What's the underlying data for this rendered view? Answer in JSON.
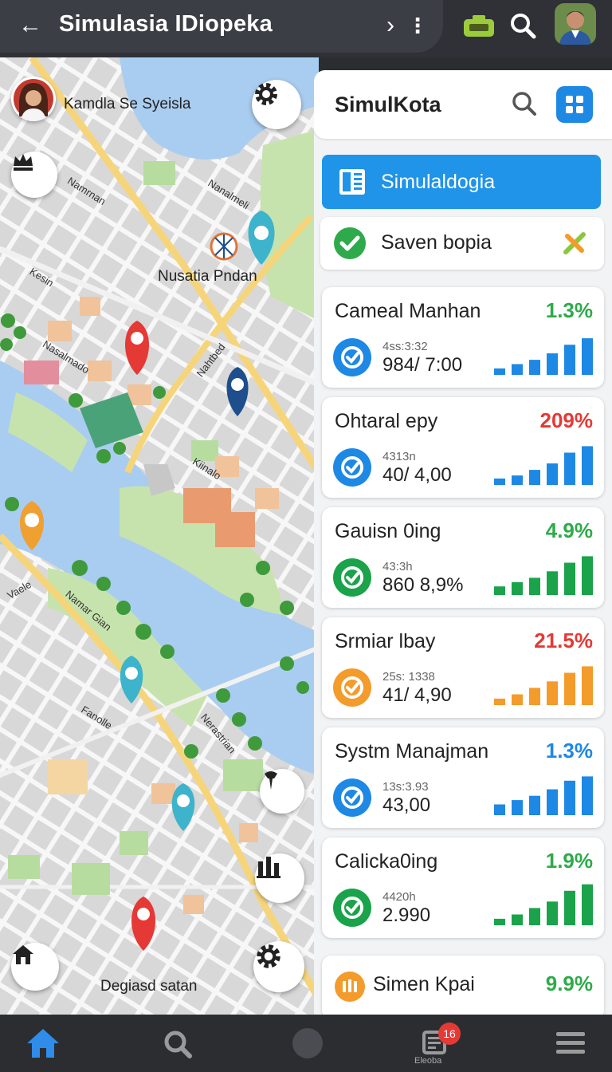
{
  "app": {
    "title": "Simulasia IDiopeka",
    "icons": {
      "back": "back-arrow-icon",
      "forward": "chevron-right-icon",
      "more": "more-vert-icon",
      "camera": "camera-icon",
      "search": "search-icon",
      "profile": "profile-avatar"
    }
  },
  "map": {
    "user_chip": "Kamdla Se Syeisla",
    "poi_label": "Nusatia Pndan",
    "bottom_label": "Degiasd satan",
    "street_labels": [
      "Namrnan",
      "Kesin",
      "Nasalmado",
      "Nanalmeli",
      "Nahtbed",
      "Kiinalo",
      "Vaele",
      "Namar Gian",
      "Nerastrian",
      "Fanolle"
    ],
    "colors": {
      "water": "#a9cdf0",
      "park": "#b7dca0",
      "road_major": "#f6d57a",
      "block": "#d9d9d9"
    }
  },
  "panel": {
    "title": "SimulKota",
    "primary_action": "Simulaldogia",
    "saved": "Saven bopia",
    "cards": [
      {
        "name": "Cameal Manhan",
        "change": "1.3%",
        "trend": "up",
        "sub": "4ss:3:32",
        "value": "984/ 7:00",
        "icon": "clock-icon",
        "color": "#1e88e5",
        "change_color": "#2eaa4a",
        "bars": [
          0.15,
          0.25,
          0.35,
          0.5,
          0.7,
          0.85
        ]
      },
      {
        "name": "Ohtaral epy",
        "change": "209%",
        "trend": "down",
        "sub": "4313n",
        "value": "40/ 4,00",
        "icon": "link-icon",
        "color": "#1e88e5",
        "change_color": "#e53935",
        "bars": [
          0.15,
          0.22,
          0.35,
          0.5,
          0.75,
          0.9
        ]
      },
      {
        "name": "Gauisn 0ing",
        "change": "4.9%",
        "trend": "up",
        "sub": "43:3h",
        "value": "860 8,9%",
        "icon": "check-icon",
        "color": "#1aa34a",
        "change_color": "#2eaa4a",
        "bars": [
          0.2,
          0.3,
          0.4,
          0.55,
          0.75,
          0.9
        ]
      },
      {
        "name": "Srmiar lbay",
        "change": "21.5%",
        "trend": "down",
        "sub": "25s: 1338",
        "value": "41/ 4,90",
        "icon": "grid-icon",
        "color": "#f39b2b",
        "change_color": "#e53935",
        "bars": [
          0.15,
          0.25,
          0.4,
          0.55,
          0.75,
          0.9
        ]
      },
      {
        "name": "Systm Manajman",
        "change": "1.3%",
        "trend": "up",
        "sub": "13s:3.93",
        "value": "43,00",
        "icon": "dollar-icon",
        "color": "#1e88e5",
        "change_color": "#1e88e5",
        "bars": [
          0.25,
          0.35,
          0.45,
          0.6,
          0.8,
          0.9
        ]
      },
      {
        "name": "Calicka0ing",
        "change": "1.9%",
        "trend": "up",
        "sub": "4420h",
        "value": "2.990",
        "icon": "gauge-icon",
        "color": "#1aa34a",
        "change_color": "#2eaa4a",
        "bars": [
          0.15,
          0.25,
          0.4,
          0.55,
          0.8,
          0.95
        ]
      },
      {
        "name": "Simen Kpai",
        "change": "9.9%",
        "trend": "up",
        "icon": "building-icon",
        "color": "#f39b2b",
        "change_color": "#2eaa4a"
      }
    ]
  },
  "bottom_nav": {
    "badge_count": "16",
    "items": [
      {
        "icon": "home-icon",
        "label": ""
      },
      {
        "icon": "search-icon",
        "label": ""
      },
      {
        "icon": "circle-icon",
        "label": ""
      },
      {
        "icon": "news-icon",
        "label": "Eleoba"
      },
      {
        "icon": "menu-icon",
        "label": ""
      }
    ]
  }
}
